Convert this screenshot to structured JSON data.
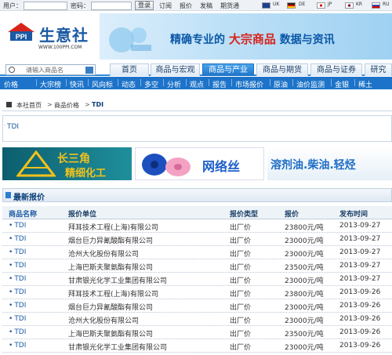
{
  "topbar": {
    "username_label": "用户：",
    "password_label": "密码：",
    "login_button": "登录",
    "links": [
      "订阅",
      "报价",
      "发稿",
      "期货通"
    ],
    "languages": [
      {
        "code": "UK",
        "flag_color": "#1f3f8f"
      },
      {
        "code": "DE",
        "flag_color": "#222222"
      },
      {
        "code": "JP",
        "flag_color": "#ffffff"
      },
      {
        "code": "KR",
        "flag_color": "#ffffff"
      },
      {
        "code": "RU",
        "flag_color": "#2a4fb0"
      }
    ]
  },
  "header": {
    "logo_abbr": "PPI",
    "logo_name": "生意社",
    "logo_url": "WWW.100PPI.COM",
    "banner_part1": "精确专业的",
    "banner_highlight": "大宗商品",
    "banner_part2": "数据与资讯"
  },
  "search": {
    "placeholder": "请输入商品名"
  },
  "nav": {
    "tabs": [
      {
        "label": "首页",
        "active": false
      },
      {
        "label": "商品与宏观",
        "active": false
      },
      {
        "label": "商品与产业",
        "active": true
      },
      {
        "label": "商品与期货",
        "active": false
      },
      {
        "label": "商品与证券",
        "active": false
      },
      {
        "label": "研究",
        "active": false
      }
    ]
  },
  "subnav": {
    "items": [
      "价格",
      "大宗榜",
      "快讯",
      "风向标",
      "动态",
      "多空",
      "分析",
      "观点",
      "报告",
      "市场报价",
      "原油",
      "油价监测",
      "金银",
      "稀土"
    ]
  },
  "breadcrumb": {
    "items": [
      "本社首页",
      "商品价格",
      "TDI"
    ]
  },
  "product": {
    "name": "TDI"
  },
  "ads": {
    "ad1_text": "长三角",
    "ad1_sub": "精细化工",
    "ad2_text": "网络丝",
    "ad3_text": "溶剂油.柴油.轻烃"
  },
  "prices": {
    "section_title": "最新报价",
    "columns": [
      "商品名称",
      "报价单位",
      "报价类型",
      "报价",
      "发布时间"
    ],
    "rows": [
      [
        "TDI",
        "拜耳技术工程(上海)有限公司",
        "出厂价",
        "23800元/吨",
        "2013-09-27"
      ],
      [
        "TDI",
        "烟台巨力异氰酸酯有限公司",
        "出厂价",
        "23000元/吨",
        "2013-09-27"
      ],
      [
        "TDI",
        "沧州大化股份有限公司",
        "出厂价",
        "23000元/吨",
        "2013-09-27"
      ],
      [
        "TDI",
        "上海巴斯夫聚氨酯有限公司",
        "出厂价",
        "23500元/吨",
        "2013-09-27"
      ],
      [
        "TDI",
        "甘肃银光化学工业集团有限公司",
        "出厂价",
        "23000元/吨",
        "2013-09-27"
      ],
      [
        "TDI",
        "拜耳技术工程(上海)有限公司",
        "出厂价",
        "23800元/吨",
        "2013-09-26"
      ],
      [
        "TDI",
        "烟台巨力异氰酸酯有限公司",
        "出厂价",
        "23000元/吨",
        "2013-09-26"
      ],
      [
        "TDI",
        "沧州大化股份有限公司",
        "出厂价",
        "23000元/吨",
        "2013-09-26"
      ],
      [
        "TDI",
        "上海巴斯夫聚氨酯有限公司",
        "出厂价",
        "23500元/吨",
        "2013-09-26"
      ],
      [
        "TDI",
        "甘肃银光化学工业集团有限公司",
        "出厂价",
        "23000元/吨",
        "2013-09-26"
      ]
    ]
  }
}
